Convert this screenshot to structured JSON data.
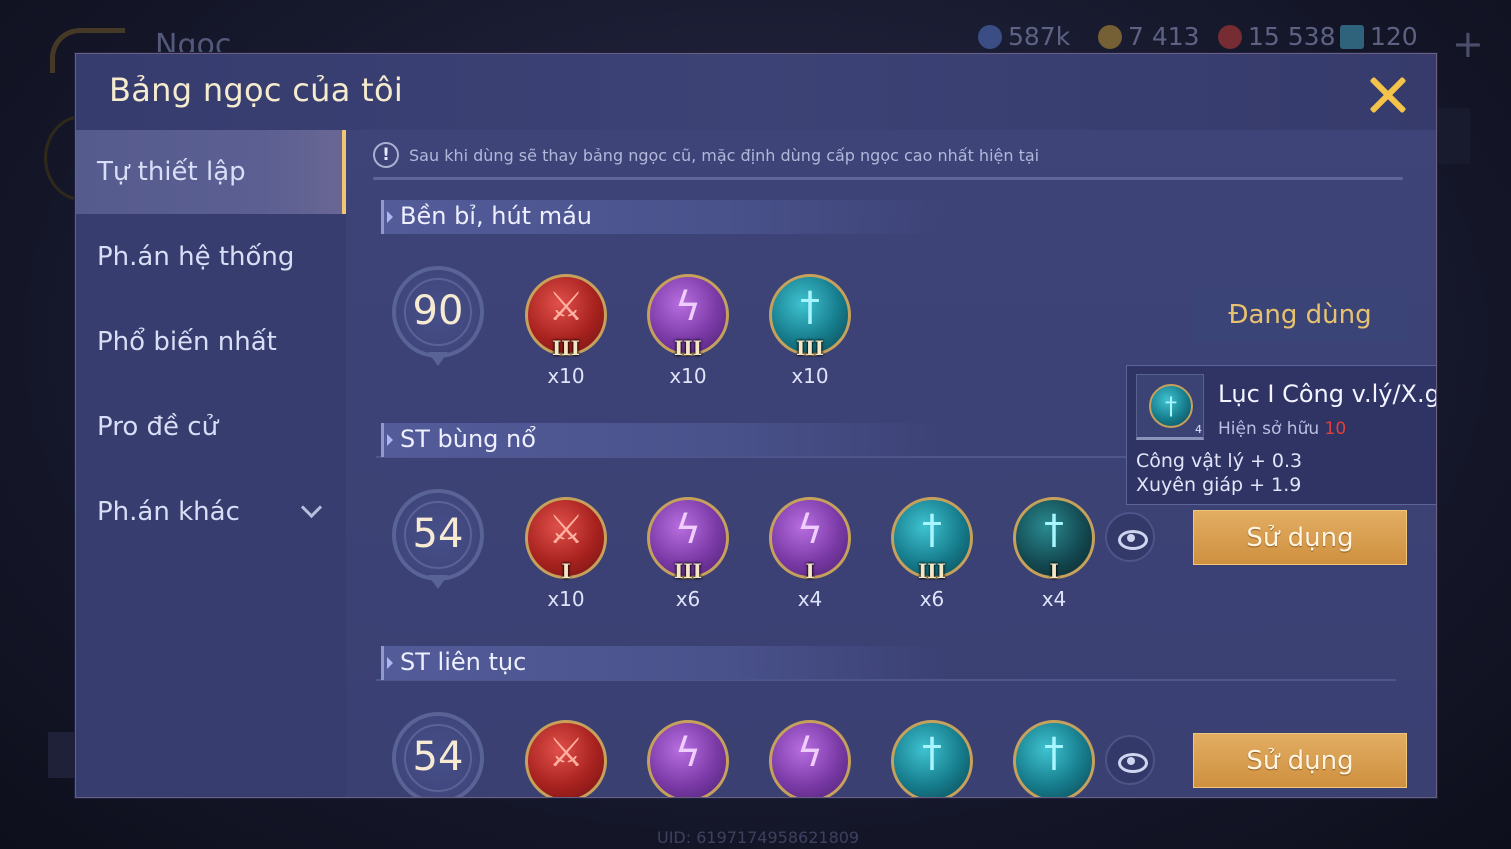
{
  "background": {
    "title": "Ngọc",
    "currencies": [
      {
        "value": "587k",
        "color": "#5a7fd8"
      },
      {
        "value": "7 413",
        "color": "#d2a43a"
      },
      {
        "value": "15 538",
        "color": "#d4403a"
      },
      {
        "value": "120",
        "color": "#4ab0d0"
      }
    ],
    "plus_icon": "plus-icon",
    "uid": "UID: 6197174958621809"
  },
  "modal": {
    "title": "Bảng ngọc của tôi",
    "close_icon": "close-icon"
  },
  "sidebar": {
    "items": [
      {
        "label": "Tự thiết lập",
        "active": true
      },
      {
        "label": "Ph.án hệ thống",
        "active": false
      },
      {
        "label": "Phổ biến nhất",
        "active": false
      },
      {
        "label": "Pro đề cử",
        "active": false
      },
      {
        "label": "Ph.án khác",
        "active": false,
        "has_dropdown": true
      }
    ]
  },
  "notice": {
    "icon": "!",
    "text": "Sau khi dùng sẽ thay bảng ngọc cũ, mặc định dùng cấp ngọc cao nhất hiện tại"
  },
  "sections": [
    {
      "name": "Bền bỉ, hút máu",
      "level": "90",
      "gems": [
        {
          "type": "red",
          "tier": "III",
          "count": "x10"
        },
        {
          "type": "purple",
          "tier": "III",
          "count": "x10"
        },
        {
          "type": "teal",
          "tier": "III",
          "count": "x10"
        }
      ],
      "status_label": "Đang dùng"
    },
    {
      "name": "ST bùng nổ",
      "level": "54",
      "gems": [
        {
          "type": "red",
          "tier": "I",
          "count": "x10"
        },
        {
          "type": "purple",
          "tier": "III",
          "count": "x6"
        },
        {
          "type": "purple",
          "tier": "I",
          "count": "x4"
        },
        {
          "type": "teal",
          "tier": "III",
          "count": "x6"
        },
        {
          "type": "dark",
          "tier": "I",
          "count": "x4"
        }
      ],
      "button_label": "Sử dụng"
    },
    {
      "name": "ST liên tục",
      "level": "54",
      "gems": [
        {
          "type": "red"
        },
        {
          "type": "purple"
        },
        {
          "type": "purple"
        },
        {
          "type": "teal"
        },
        {
          "type": "teal"
        }
      ],
      "button_label": "Sử dụng"
    }
  ],
  "tooltip": {
    "name": "Lục I Công v.lý/X.giáp",
    "level_badge": "4",
    "owned_label": "Hiện sở hữu",
    "owned_count": "10",
    "stats": [
      "Công vật lý + 0.3",
      "Xuyên giáp + 1.9"
    ]
  }
}
